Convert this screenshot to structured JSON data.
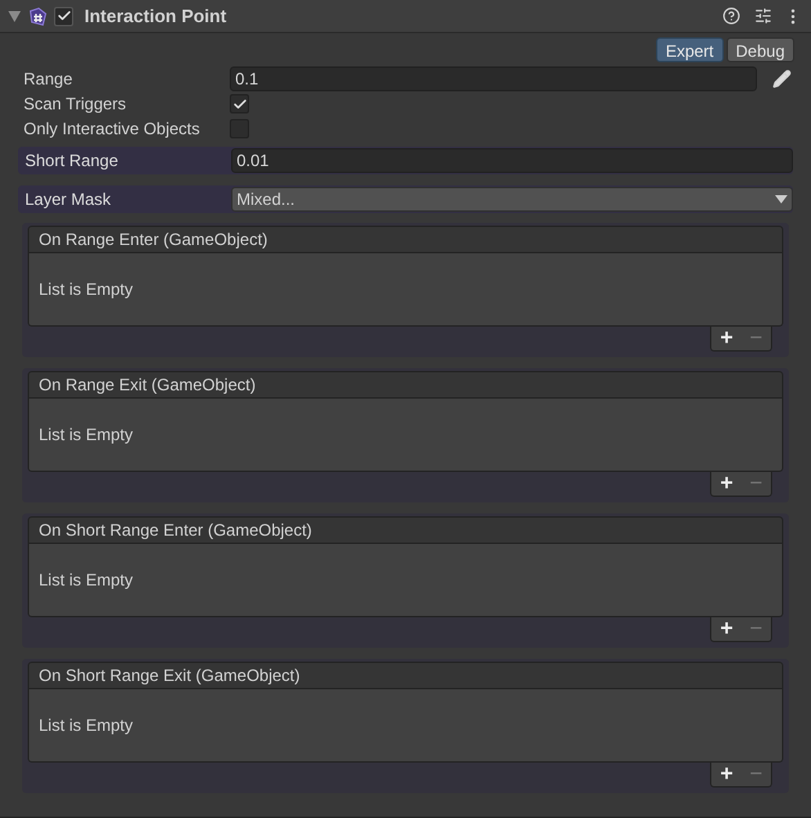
{
  "component": {
    "title": "Interaction Point",
    "enabled": true,
    "expanded": true
  },
  "modes": [
    {
      "label": "Expert",
      "selected": true
    },
    {
      "label": "Debug",
      "selected": false
    }
  ],
  "fields": [
    {
      "kind": "text",
      "label": "Range",
      "value": "0.1",
      "editable_icon": true,
      "highlighted": false
    },
    {
      "kind": "checkbox",
      "label": "Scan Triggers",
      "checked": true,
      "highlighted": false
    },
    {
      "kind": "checkbox",
      "label": "Only Interactive Objects",
      "checked": false,
      "highlighted": false
    },
    {
      "kind": "text",
      "label": "Short Range",
      "value": "0.01",
      "editable_icon": false,
      "highlighted": true
    },
    {
      "kind": "dropdown",
      "label": "Layer Mask",
      "value": "Mixed...",
      "highlighted": true
    }
  ],
  "events": [
    {
      "title": "On Range Enter (GameObject)",
      "empty_text": "List is Empty",
      "add": "+",
      "remove": "−",
      "remove_disabled": true
    },
    {
      "title": "On Range Exit (GameObject)",
      "empty_text": "List is Empty",
      "add": "+",
      "remove": "−",
      "remove_disabled": true
    },
    {
      "title": "On Short Range Enter (GameObject)",
      "empty_text": "List is Empty",
      "add": "+",
      "remove": "−",
      "remove_disabled": true
    },
    {
      "title": "On Short Range Exit (GameObject)",
      "empty_text": "List is Empty",
      "add": "+",
      "remove": "−",
      "remove_disabled": true
    }
  ]
}
